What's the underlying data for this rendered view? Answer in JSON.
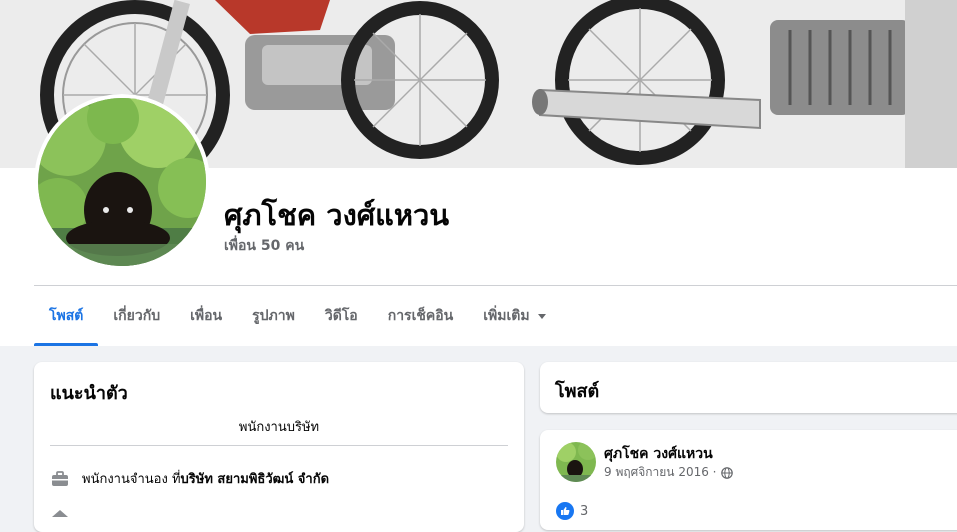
{
  "profile": {
    "name": "ศุภโชค วงศ์แหวน",
    "friends": "เพื่อน 50 คน"
  },
  "tabs": [
    {
      "label": "โพสต์",
      "active": true
    },
    {
      "label": "เกี่ยวกับ",
      "active": false
    },
    {
      "label": "เพื่อน",
      "active": false
    },
    {
      "label": "รูปภาพ",
      "active": false
    },
    {
      "label": "วิดีโอ",
      "active": false
    },
    {
      "label": "การเช็คอิน",
      "active": false
    },
    {
      "label": "เพิ่มเติม",
      "active": false
    }
  ],
  "intro": {
    "title": "แนะนำตัว",
    "bio": "พนักงานบริษัท",
    "work_prefix": "พนักงานจำนอง ที่ ",
    "work_company": "บริษัท สยามพิธิวัฒน์ จำกัด"
  },
  "posts": {
    "title": "โพสต์",
    "items": [
      {
        "author": "ศุภโชค วงศ์แหวน",
        "date": "9 พฤศจิกายน 2016 ·",
        "likes": "3"
      }
    ]
  },
  "colors": {
    "accent": "#1b74e4",
    "muted_text": "#65676b",
    "background": "#f0f2f5",
    "like_blue": "#1877f2"
  },
  "icons": {
    "privacy": "globe-icon",
    "work": "briefcase-icon",
    "reaction": "like-icon",
    "more": "caret-down-icon"
  }
}
